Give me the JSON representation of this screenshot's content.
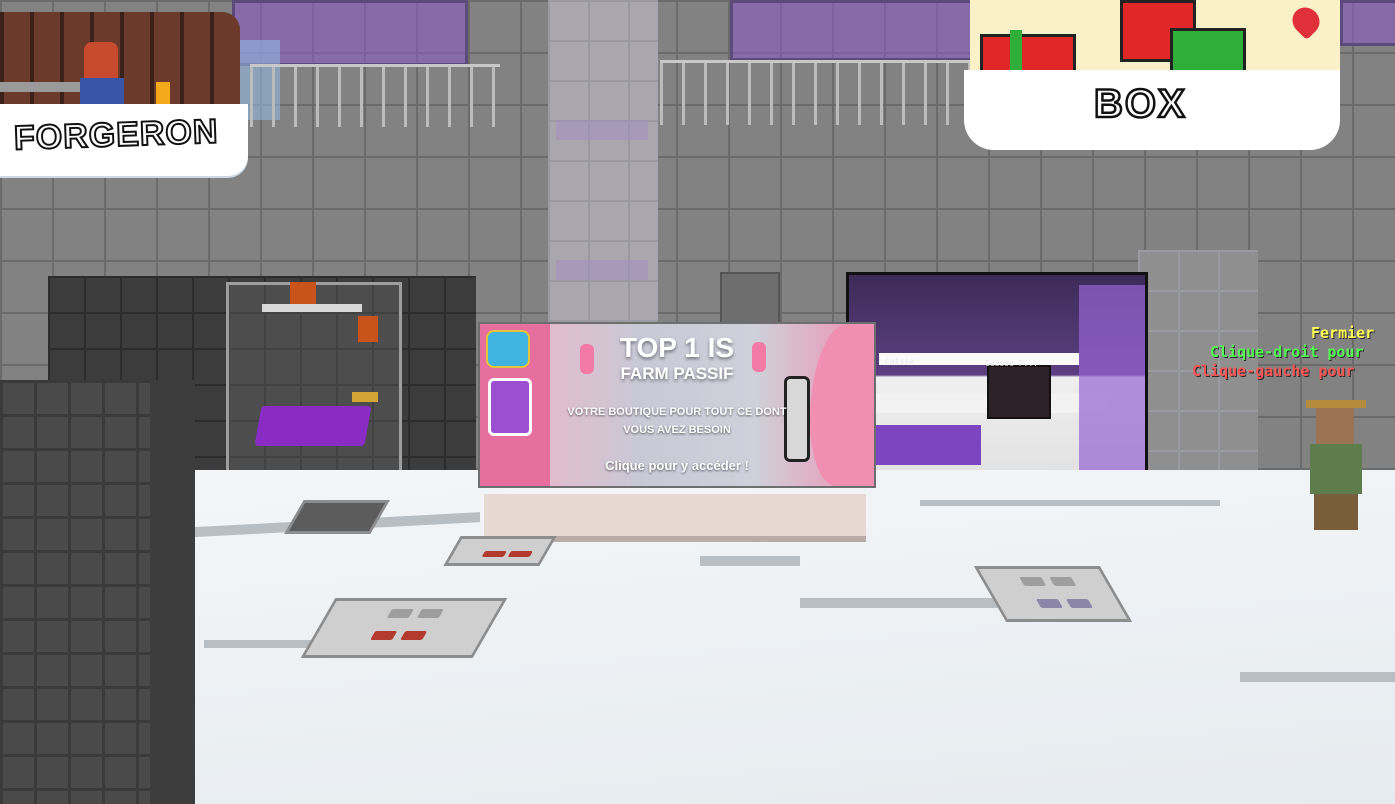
{
  "scene": {
    "signs": {
      "forgeron": "FORGERON",
      "box": "BOX"
    },
    "banner": {
      "title": "TOP 1 IS",
      "subtitle": "FARM PASSIF",
      "line1": "VOTRE BOUTIQUE POUR TOUT CE DONT",
      "line2": "VOUS AVEZ BESOIN",
      "cta": "Clique pour y accéder !"
    },
    "shop_window": {
      "label_left": "Caisse",
      "label_right": "Caisse P..."
    },
    "npc": {
      "name": "Fermier",
      "right_click": "Clique-droit pour",
      "left_click": "Clique-gauche pour",
      "colors": {
        "name": "#ffff55",
        "right_click": "#55ff55",
        "left_click": "#ff5555"
      }
    }
  }
}
